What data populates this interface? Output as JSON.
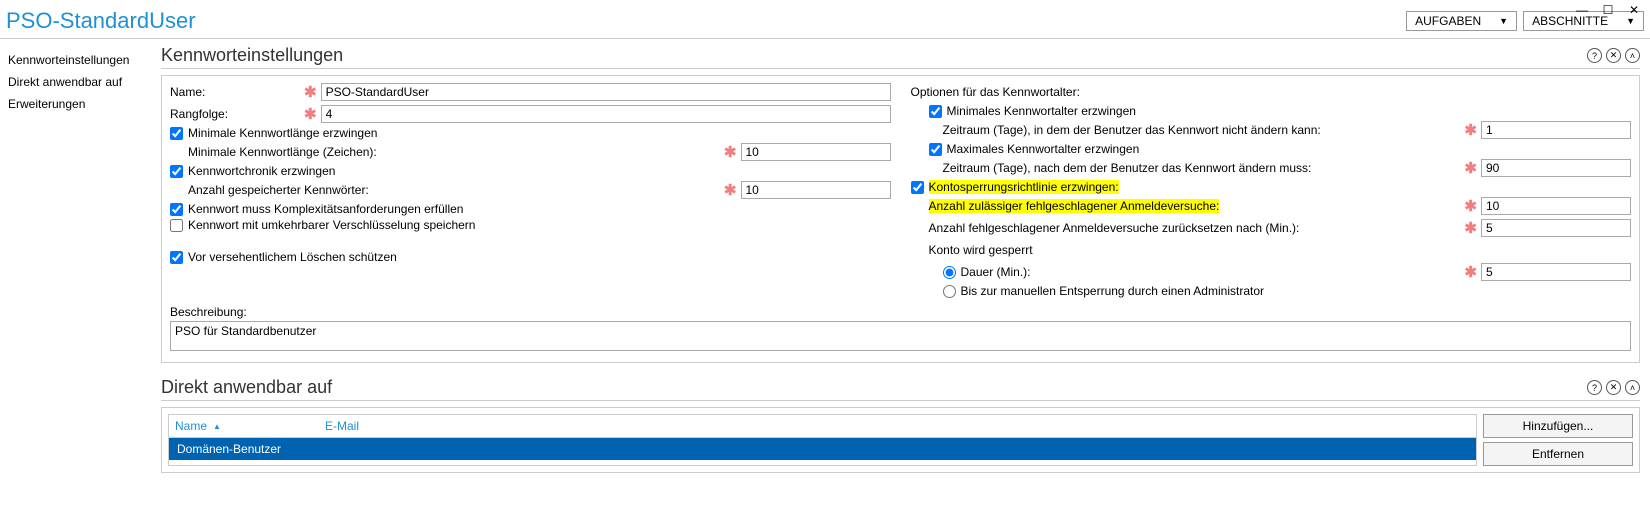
{
  "window": {
    "minimize": "—",
    "maximize": "☐",
    "close": "✕"
  },
  "header": {
    "title": "PSO-StandardUser",
    "btn_tasks": "AUFGABEN",
    "btn_sections": "ABSCHNITTE"
  },
  "sidebar": {
    "items": [
      "Kennworteinstellungen",
      "Direkt anwendbar auf",
      "Erweiterungen"
    ]
  },
  "icons": {
    "help": "?",
    "close": "✕",
    "up": "˄"
  },
  "section1": {
    "title": "Kennworteinstellungen",
    "name_label": "Name:",
    "name_value": "PSO-StandardUser",
    "rank_label": "Rangfolge:",
    "rank_value": "4",
    "minlen_chk": "Minimale Kennwortlänge erzwingen",
    "minlen_label": "Minimale Kennwortlänge (Zeichen):",
    "minlen_value": "10",
    "history_chk": "Kennwortchronik erzwingen",
    "history_label": "Anzahl gespeicherter Kennwörter:",
    "history_value": "10",
    "complexity_chk": "Kennwort muss Komplexitätsanforderungen erfüllen",
    "reversible_chk": "Kennwort mit umkehrbarer Verschlüsselung speichern",
    "protect_chk": "Vor versehentlichem Löschen schützen",
    "desc_label": "Beschreibung:",
    "desc_value": "PSO für Standardbenutzer",
    "age_title": "Optionen für das Kennwortalter:",
    "minage_chk": "Minimales Kennwortalter erzwingen",
    "minage_label": "Zeitraum (Tage), in dem der Benutzer das Kennwort nicht ändern kann:",
    "minage_value": "1",
    "maxage_chk": "Maximales Kennwortalter erzwingen",
    "maxage_label": "Zeitraum (Tage), nach dem der Benutzer das Kennwort ändern muss:",
    "maxage_value": "90",
    "lockout_chk": "Kontosperrungsrichtlinie erzwingen:",
    "failed_label": "Anzahl zulässiger fehlgeschlagener Anmeldeversuche:",
    "failed_value": "10",
    "reset_label": "Anzahl fehlgeschlagener Anmeldeversuche zurücksetzen nach (Min.):",
    "reset_value": "5",
    "locked_label": "Konto wird gesperrt",
    "duration_radio": "Dauer (Min.):",
    "duration_value": "5",
    "manual_radio": "Bis zur manuellen Entsperrung durch einen Administrator"
  },
  "section2": {
    "title": "Direkt anwendbar auf",
    "col_name": "Name",
    "col_mail": "E-Mail",
    "row0_name": "Domänen-Benutzer",
    "row0_mail": "",
    "btn_add": "Hinzufügen...",
    "btn_remove": "Entfernen"
  }
}
